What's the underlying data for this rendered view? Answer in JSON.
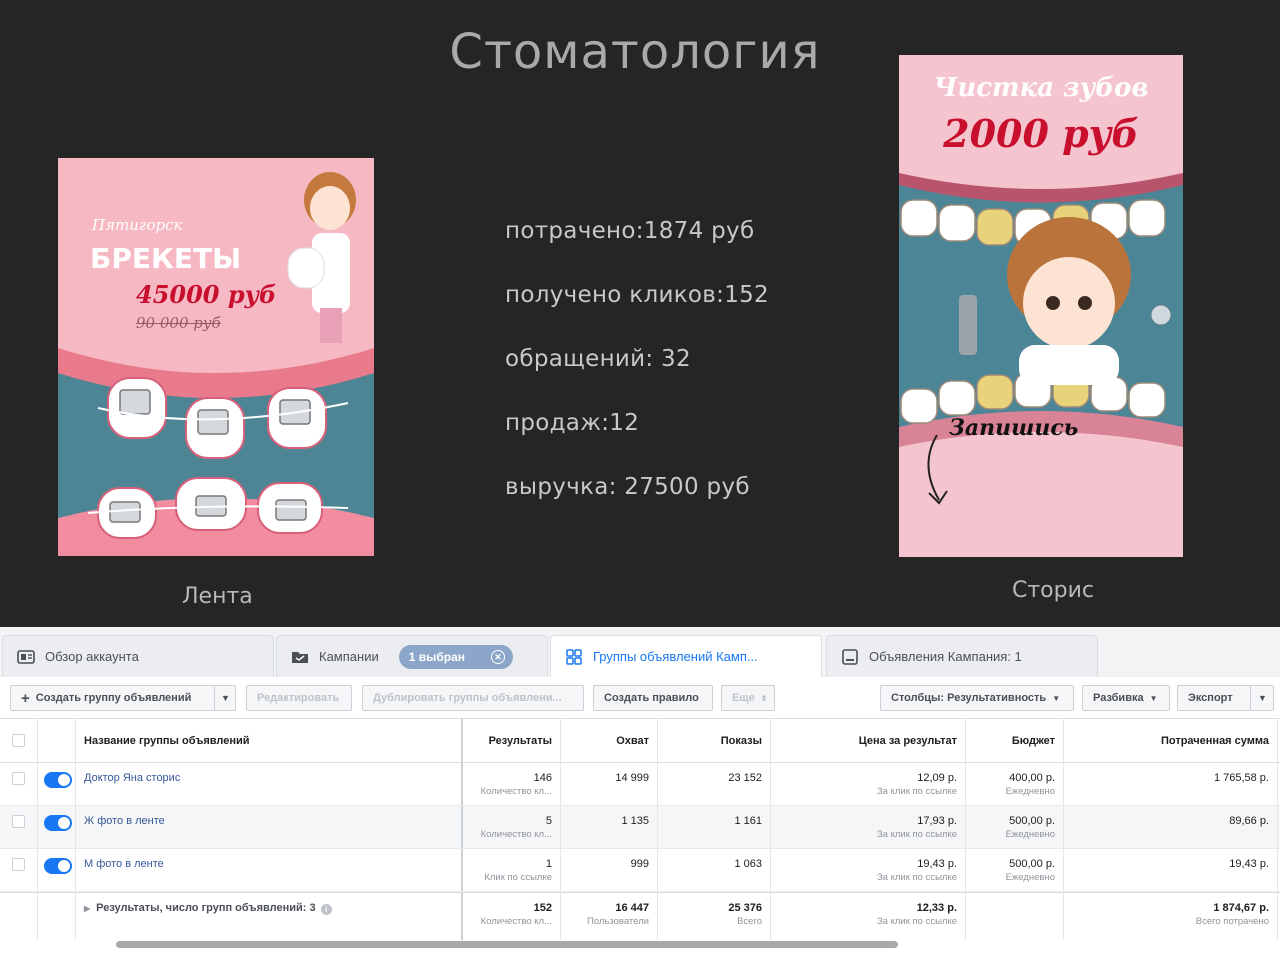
{
  "slide": {
    "title": "Стоматология",
    "feed_caption": "Лента",
    "story_caption": "Сторис",
    "feed_ad": {
      "city": "Пятигорск",
      "product": "БРЕКЕТЫ",
      "price": "45000 руб",
      "old_price": "90 000 руб"
    },
    "story_ad": {
      "line1": "Чистка зубов",
      "price": "2000 руб",
      "cta": "Запишись"
    },
    "stats": [
      "потрачено:1874 руб",
      "получено кликов:152",
      "обращений: 32",
      "продаж:12",
      "выручка: 27500 руб"
    ]
  },
  "manager": {
    "tabs": {
      "account": "Обзор аккаунта",
      "campaigns": "Кампании",
      "selected_badge": "1 выбран",
      "adsets": "Группы объявлений Камп...",
      "ads": "Объявления Кампания: 1"
    },
    "toolbar": {
      "create": "Создать группу объявлений",
      "edit": "Редактировать",
      "duplicate": "Дублировать группы объявлени...",
      "rule": "Создать правило",
      "more": "Еще",
      "columns": "Столбцы: Результативность",
      "breakdown": "Разбивка",
      "export": "Экспорт"
    },
    "headers": {
      "name": "Название группы объявлений",
      "results": "Результаты",
      "reach": "Охват",
      "impressions": "Показы",
      "cpr": "Цена за результат",
      "budget": "Бюджет",
      "spent": "Потраченная сумма"
    },
    "rows": [
      {
        "name": "Доктор Яна сторис",
        "results": "146",
        "results_sub": "Количество кл...",
        "reach": "14 999",
        "impressions": "23 152",
        "cpr": "12,09 р.",
        "cpr_sub": "За клик по ссылке",
        "budget": "400,00 р.",
        "budget_sub": "Ежедневно",
        "spent": "1 765,58 р."
      },
      {
        "name": "Ж фото в ленте",
        "results": "5",
        "results_sub": "Количество кл...",
        "reach": "1 135",
        "impressions": "1 161",
        "cpr": "17,93 р.",
        "cpr_sub": "За клик по ссылке",
        "budget": "500,00 р.",
        "budget_sub": "Ежедневно",
        "spent": "89,66 р."
      },
      {
        "name": "М фото в ленте",
        "results": "1",
        "results_sub": "Клик по ссылке",
        "reach": "999",
        "impressions": "1 063",
        "cpr": "19,43 р.",
        "cpr_sub": "За клик по ссылке",
        "budget": "500,00 р.",
        "budget_sub": "Ежедневно",
        "spent": "19,43 р."
      }
    ],
    "totals": {
      "label": "Результаты, число групп объявлений: 3",
      "results": "152",
      "results_sub": "Количество кл...",
      "reach": "16 447",
      "reach_sub": "Пользователи",
      "impressions": "25 376",
      "impressions_sub": "Всего",
      "cpr": "12,33 р.",
      "cpr_sub": "За клик по ссылке",
      "spent": "1 874,67 р.",
      "spent_sub": "Всего потрачено"
    }
  }
}
